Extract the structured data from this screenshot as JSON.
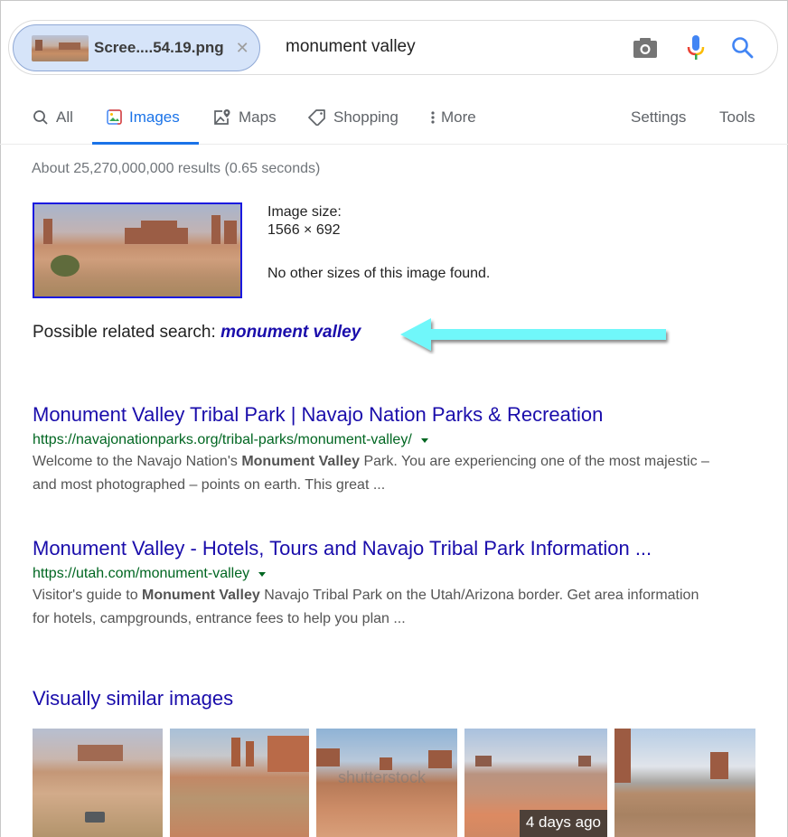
{
  "search": {
    "image_chip": {
      "filename": "Scree....54.19.png",
      "close_icon": "close-icon"
    },
    "query": "monument valley",
    "icons": [
      "camera-icon",
      "microphone-icon",
      "search-icon"
    ]
  },
  "tabs": [
    {
      "label": "All",
      "icon": "search-icon",
      "active": false
    },
    {
      "label": "Images",
      "icon": "image-icon",
      "active": true
    },
    {
      "label": "Maps",
      "icon": "map-pin-icon",
      "active": false
    },
    {
      "label": "Shopping",
      "icon": "tag-icon",
      "active": false
    },
    {
      "label": "More",
      "icon": "more-vert-icon",
      "active": false
    }
  ],
  "tools": {
    "settings": "Settings",
    "tools": "Tools"
  },
  "stats": "About 25,270,000,000 results (0.65 seconds)",
  "image_info": {
    "size_label": "Image size:",
    "size_value": "1566 × 692",
    "no_sizes": "No other sizes of this image found."
  },
  "related": {
    "label": "Possible related search: ",
    "link": "monument valley",
    "annotation_color": "#6ff7fa"
  },
  "results": [
    {
      "title": "Monument Valley Tribal Park | Navajo Nation Parks & Recreation",
      "url": "https://navajonationparks.org/tribal-parks/monument-valley/",
      "snippet_pre": "Welcome to the Navajo Nation's ",
      "snippet_bold": "Monument Valley",
      "snippet_post": " Park. You are experiencing one of the most majestic – and most photographed – points on earth. This great ..."
    },
    {
      "title": "Monument Valley - Hotels, Tours and Navajo Tribal Park Information ...",
      "url": "https://utah.com/monument-valley",
      "snippet_pre": "Visitor's guide to ",
      "snippet_bold": "Monument Valley",
      "snippet_post": " Navajo Tribal Park on the Utah/Arizona border. Get area information for hotels, campgrounds, entrance fees to help you plan ..."
    }
  ],
  "similar": {
    "title": "Visually similar images",
    "images": [
      {
        "alt": "desert riders with car",
        "badge": ""
      },
      {
        "alt": "three sisters buttes",
        "badge": ""
      },
      {
        "alt": "shutterstock mittens view",
        "badge": "",
        "watermark": "shutterstock"
      },
      {
        "alt": "valley plain with buttes",
        "badge": "4 days ago"
      },
      {
        "alt": "mitten butte with clouds",
        "badge": ""
      }
    ]
  },
  "colors": {
    "link": "#1a0dab",
    "url": "#006621",
    "accent": "#1a73e8",
    "snippet": "#545454"
  }
}
